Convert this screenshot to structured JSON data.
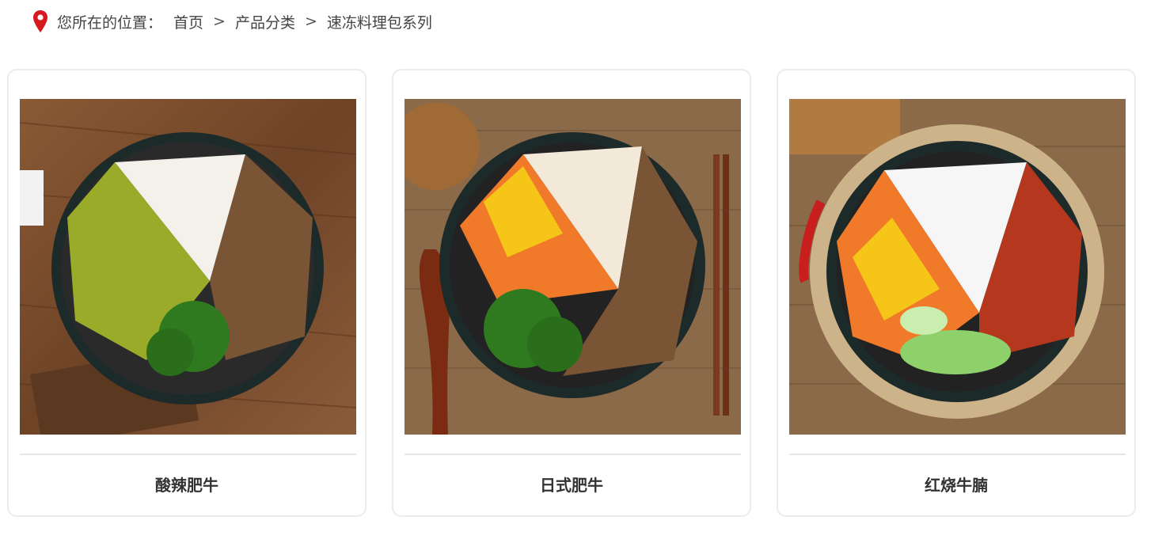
{
  "breadcrumb": {
    "prefix": "您所在的位置：",
    "items": [
      "首页",
      "产品分类",
      "速冻料理包系列"
    ],
    "separator": ">"
  },
  "products": [
    {
      "name": "酸辣肥牛",
      "image": "rice-bowl-sour-spicy-beef-image"
    },
    {
      "name": "日式肥牛",
      "image": "rice-bowl-japanese-beef-image"
    },
    {
      "name": "红烧牛腩",
      "image": "rice-bowl-braised-brisket-image"
    }
  ],
  "colors": {
    "pin": "#d6181f",
    "wood_dark": "#7a4a2a",
    "wood_light": "#9a6a45",
    "rice": "#f4f1ea",
    "broccoli": "#2f7a1e",
    "carrot": "#f07a2a",
    "corn": "#f5c518",
    "beef": "#7a5535",
    "brisket": "#b5381e",
    "bokchoy": "#8ed06a",
    "bowl": "#1d2a2a"
  }
}
